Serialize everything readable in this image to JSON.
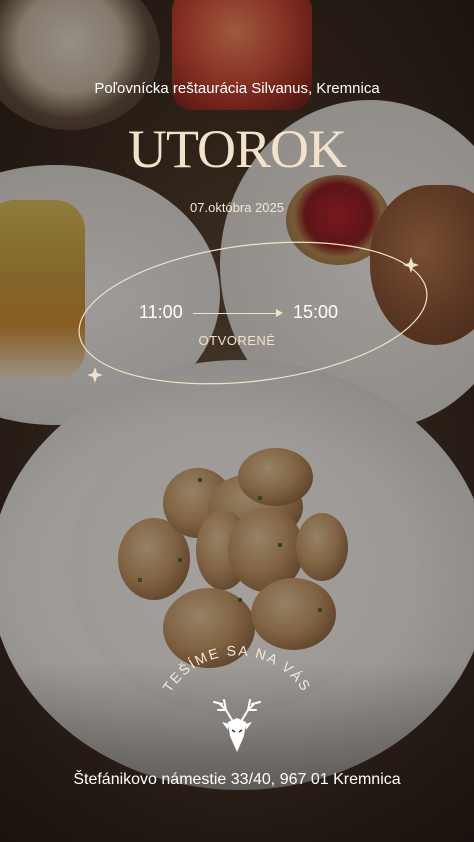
{
  "restaurant_line": "Poľovnícka reštaurácia Silvanus, Kremnica",
  "day": "UTOROK",
  "date": "07.októbra 2025",
  "hours": {
    "open": "11:00",
    "close": "15:00",
    "status": "OTVORENÉ"
  },
  "greeting": "TEŠÍME SA NA VÁS",
  "address": "Štefánikovo námestie 33/40, 967 01 Kremnica",
  "colors": {
    "accent": "#f1e2c9",
    "text": "#ffffff"
  },
  "icons": {
    "logo": "deer-head-icon",
    "sparkle": "sparkle-icon"
  }
}
